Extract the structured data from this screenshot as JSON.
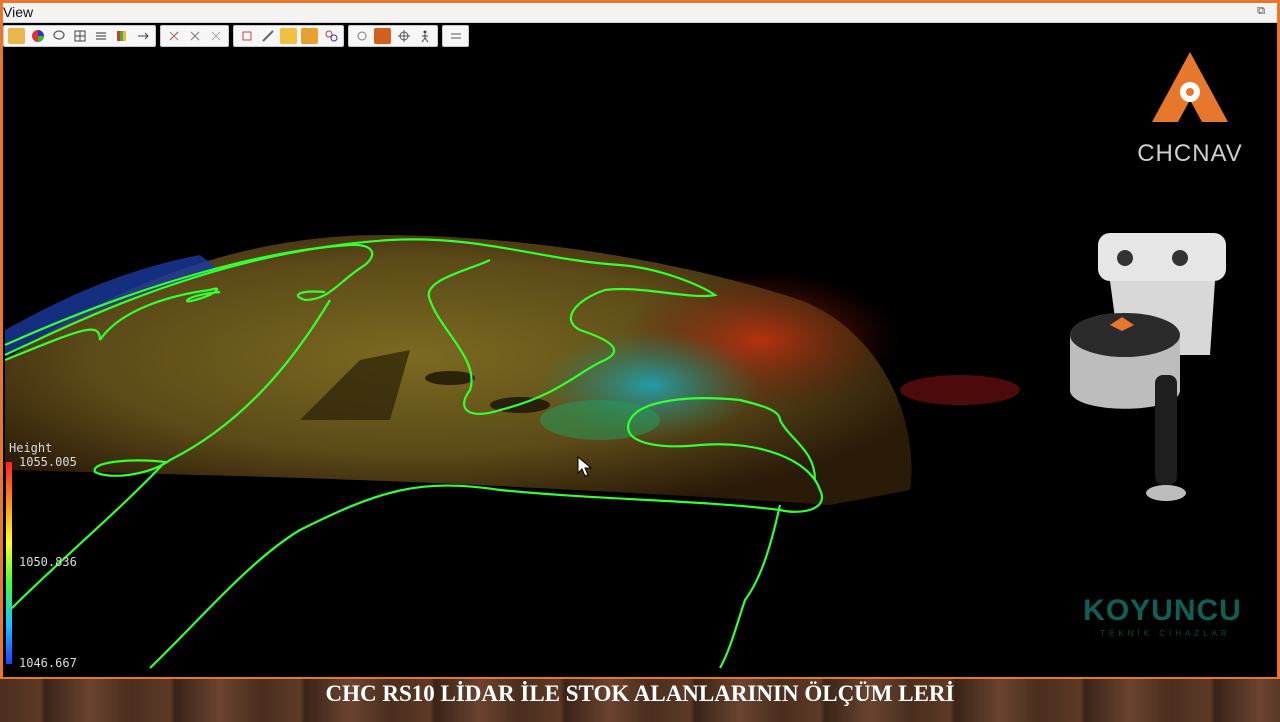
{
  "window": {
    "title": "View"
  },
  "toolbar": {
    "groups": [
      [
        "chart-icon",
        "color-wheel-icon",
        "lasso-icon",
        "grid-icon",
        "list-icon",
        "palette-icon",
        "arrows-icon"
      ],
      [
        "select-icon",
        "cut-icon",
        "crop-icon"
      ],
      [
        "box-icon",
        "ruler-icon",
        "link-icon",
        "layers-icon",
        "filter-icon"
      ],
      [
        "rotate-icon",
        "cube-icon",
        "target-icon",
        "walk-icon"
      ],
      [
        "settings-icon"
      ]
    ]
  },
  "legend": {
    "label": "Height",
    "max": "1055.005",
    "mid": "1050.836",
    "min": "1046.667"
  },
  "branding": {
    "chcnav": "CHCNAV",
    "koyuncu": "KOYUNCU",
    "koyuncu_sub": "TEKNİK CİHAZLAR"
  },
  "banner": {
    "text": "CHC RS10 LİDAR İLE STOK ALANLARININ  ÖLÇÜM LERİ"
  },
  "colors": {
    "accent": "#e8772e",
    "contour": "#33ff33"
  }
}
